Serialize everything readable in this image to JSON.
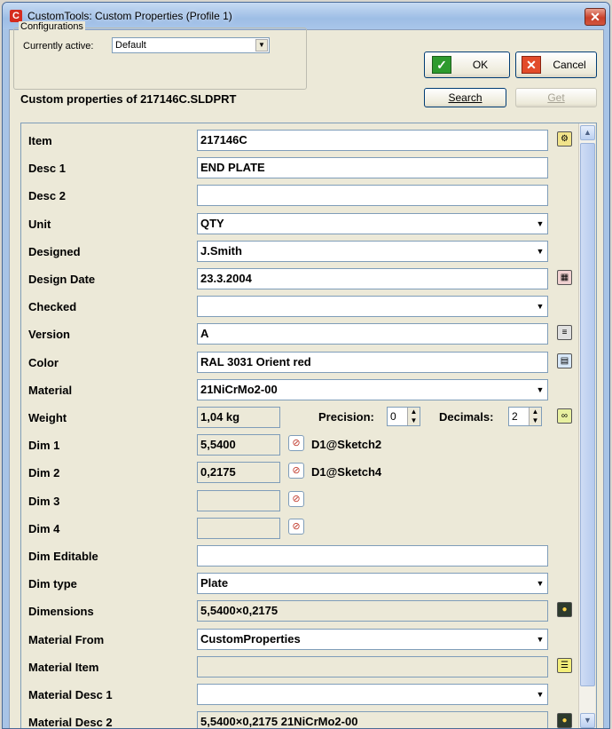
{
  "window": {
    "title": "CustomTools: Custom Properties (Profile 1)",
    "app_icon": "C"
  },
  "colors": {
    "title_gradient_top": "#c7dbf3",
    "client_bg": "#ece9d8",
    "close_red": "#c8402a",
    "ok_green": "#2e9a2e",
    "cancel_red": "#e24b2a"
  },
  "configurations": {
    "legend": "Configurations",
    "label": "Currently active:",
    "value": "Default"
  },
  "caption": "Custom properties of 217146C.SLDPRT",
  "buttons": {
    "ok": "OK",
    "cancel": "Cancel",
    "search": "Search",
    "get": "Get"
  },
  "properties": [
    {
      "label": "Item",
      "value": "217146C",
      "kind": "text",
      "icon": "filter-icon"
    },
    {
      "label": "Desc 1",
      "value": "END PLATE",
      "kind": "text"
    },
    {
      "label": "Desc 2",
      "value": "",
      "kind": "text"
    },
    {
      "label": "Unit",
      "value": "QTY",
      "kind": "combo"
    },
    {
      "label": "Designed",
      "value": "J.Smith",
      "kind": "combo"
    },
    {
      "label": "Design Date",
      "value": "23.3.2004",
      "kind": "text",
      "icon": "calendar-icon"
    },
    {
      "label": "Checked",
      "value": "",
      "kind": "combo"
    },
    {
      "label": "Version",
      "value": "A",
      "kind": "text",
      "icon": "revision-icon"
    },
    {
      "label": "Color",
      "value": "RAL 3031 Orient red",
      "kind": "text",
      "icon": "color-palette-icon"
    },
    {
      "label": "Material",
      "value": "21NiCrMo2-00",
      "kind": "combo"
    },
    {
      "label": "Weight",
      "value": "1,04 kg",
      "kind": "weight",
      "icon": "calculate-icon"
    },
    {
      "label": "Dim 1",
      "value": "5,5400",
      "kind": "dim",
      "ref": "D1@Sketch2"
    },
    {
      "label": "Dim 2",
      "value": "0,2175",
      "kind": "dim",
      "ref": "D1@Sketch4"
    },
    {
      "label": "Dim 3",
      "value": "",
      "kind": "dim",
      "ref": ""
    },
    {
      "label": "Dim 4",
      "value": "",
      "kind": "dim",
      "ref": ""
    },
    {
      "label": "Dim Editable",
      "value": "",
      "kind": "text"
    },
    {
      "label": "Dim type",
      "value": "Plate",
      "kind": "combo"
    },
    {
      "label": "Dimensions",
      "value": "5,5400×0,2175",
      "kind": "readonly",
      "icon": "traffic-light-icon"
    },
    {
      "label": "Material From",
      "value": "CustomProperties",
      "kind": "combo"
    },
    {
      "label": "Material Item",
      "value": "",
      "kind": "readonly",
      "icon": "list-icon"
    },
    {
      "label": "Material Desc 1",
      "value": "",
      "kind": "combo"
    },
    {
      "label": "Material Desc 2",
      "value": "5,5400×0,2175 21NiCrMo2-00",
      "kind": "readonly",
      "icon": "traffic-light-icon"
    }
  ],
  "weight_controls": {
    "precision_label": "Precision:",
    "precision_value": "0",
    "decimals_label": "Decimals:",
    "decimals_value": "2"
  }
}
